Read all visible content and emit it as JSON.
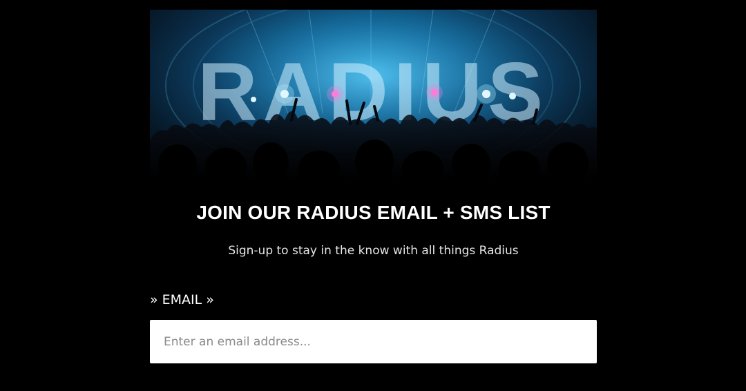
{
  "hero": {
    "brand_text": "RADIUS"
  },
  "signup": {
    "title": "JOIN OUR RADIUS EMAIL + SMS LIST",
    "subtitle": "Sign-up to stay in the know with all things Radius",
    "email_label": "» EMAIL »",
    "email_placeholder": "Enter an email address...",
    "email_value": ""
  },
  "colors": {
    "background": "#000000",
    "text": "#ffffff",
    "input_background": "#ffffff",
    "hero_accent": "#2aa6d8"
  }
}
